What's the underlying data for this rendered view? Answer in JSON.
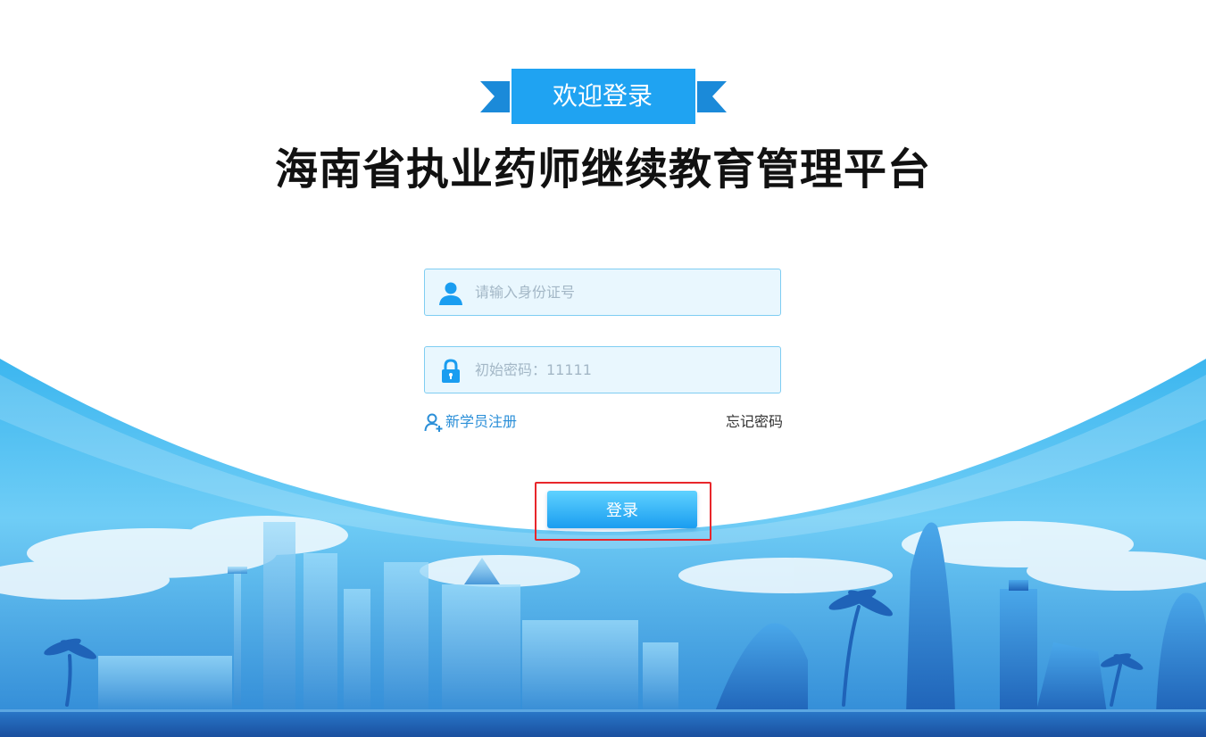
{
  "banner": {
    "label": "欢迎登录"
  },
  "title": "海南省执业药师继续教育管理平台",
  "login_form": {
    "id_card_placeholder": "请输入身份证号",
    "password_placeholder": "初始密码：11111",
    "register_label": "新学员注册",
    "forgot_label": "忘记密码",
    "submit_label": "登录"
  },
  "icons": {
    "id_field": "user-icon",
    "password_field": "lock-icon",
    "register": "add-user-icon"
  },
  "colors": {
    "accent": "#1a9df0",
    "banner": "#1fa3f2",
    "highlight": "#e8262b",
    "field_bg": "#e9f7fe",
    "field_border": "#7fcdf2",
    "link": "#2b8fd8"
  }
}
